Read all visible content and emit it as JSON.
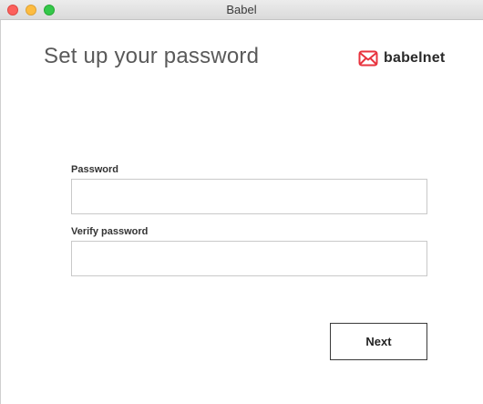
{
  "window": {
    "title": "Babel"
  },
  "header": {
    "title": "Set up your password",
    "brand_name": "babelnet",
    "brand_icon": "envelope-logo-icon",
    "brand_color": "#e8343f"
  },
  "form": {
    "password_label": "Password",
    "password_value": "",
    "password_placeholder": "",
    "verify_label": "Verify password",
    "verify_value": "",
    "verify_placeholder": "",
    "next_label": "Next"
  }
}
